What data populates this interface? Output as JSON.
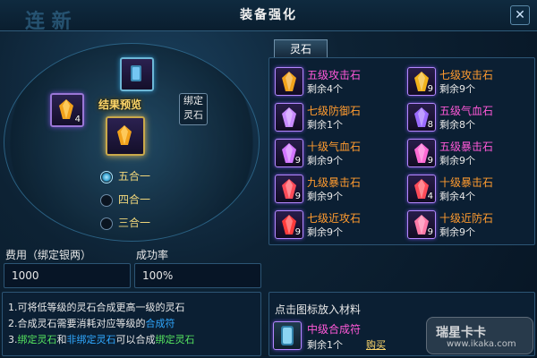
{
  "window": {
    "title": "装备强化",
    "deco_text": "连 新",
    "close_glyph": "✕"
  },
  "left_panel": {
    "preview_label": "结果预览",
    "bind_button_label": "绑定\n灵石",
    "small_slot_count": "4",
    "options": [
      {
        "label": "五合一",
        "selected": true
      },
      {
        "label": "四合一",
        "selected": false
      },
      {
        "label": "三合一",
        "selected": false
      }
    ]
  },
  "fields": {
    "cost_label": "费用（绑定银两）",
    "cost_value": "1000",
    "rate_label": "成功率",
    "rate_value": "100%"
  },
  "info": {
    "line1": "1.可将低等级的灵石合成更高一级的灵石",
    "line2_prefix": "2.合成灵石需要消耗对应等级的",
    "line2_highlight": "合成符",
    "line3_a": "3.",
    "line3_b": "绑定灵石",
    "line3_c": "和",
    "line3_d": "非绑定灵石",
    "line3_e": "可以合成",
    "line3_f": "绑定灵石"
  },
  "tabs": [
    {
      "label": "灵石"
    }
  ],
  "items": [
    {
      "name": "五级攻击石",
      "name_color": "purple",
      "remain": "剩余4个",
      "count": "",
      "icon": "gold-gem-icon",
      "color": "#f2a21b"
    },
    {
      "name": "七级攻击石",
      "name_color": "orange",
      "remain": "剩余9个",
      "count": "9",
      "icon": "gold-gem-icon",
      "color": "#f2b21b"
    },
    {
      "name": "七级防御石",
      "name_color": "orange",
      "remain": "剩余1个",
      "count": "",
      "icon": "purple-crystal-icon",
      "color": "#c98bff"
    },
    {
      "name": "五级气血石",
      "name_color": "purple",
      "remain": "剩余8个",
      "count": "8",
      "icon": "purple-crystal-icon",
      "color": "#9b6bff"
    },
    {
      "name": "十级气血石",
      "name_color": "orange",
      "remain": "剩余9个",
      "count": "9",
      "icon": "purple-gem-icon",
      "color": "#d276ff"
    },
    {
      "name": "五级暴击石",
      "name_color": "purple",
      "remain": "剩余9个",
      "count": "9",
      "icon": "pink-gem-icon",
      "color": "#ff6ad5"
    },
    {
      "name": "九级暴击石",
      "name_color": "orange",
      "remain": "剩余9个",
      "count": "9",
      "icon": "red-gem-icon",
      "color": "#ff4a58"
    },
    {
      "name": "十级暴击石",
      "name_color": "orange",
      "remain": "剩余4个",
      "count": "4",
      "icon": "red-gem-icon",
      "color": "#ff4a58"
    },
    {
      "name": "七级近攻石",
      "name_color": "orange",
      "remain": "剩余9个",
      "count": "9",
      "icon": "red-green-gem-icon",
      "color": "#ff3b3b"
    },
    {
      "name": "十级近防石",
      "name_color": "orange",
      "remain": "剩余9个",
      "count": "9",
      "icon": "pink-crystal-icon",
      "color": "#ff7aa8"
    }
  ],
  "materials": {
    "hint": "点击图标放入材料",
    "name": "中级合成符",
    "remain": "剩余1个",
    "buy_label": "购买",
    "icon": "scroll-icon"
  },
  "logo": {
    "line1": "瑞星卡卡",
    "line2": "www.ikaka.com"
  }
}
